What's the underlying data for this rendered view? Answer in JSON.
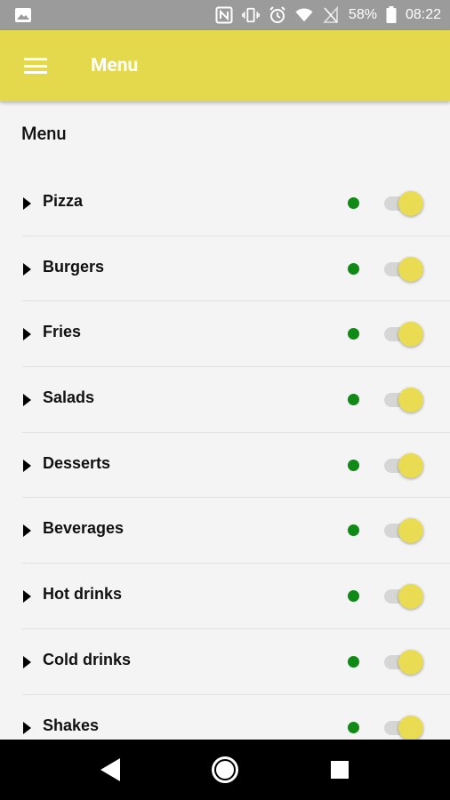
{
  "status_bar": {
    "battery_percent": "58%",
    "time": "08:22",
    "icons": [
      "gallery-icon",
      "nfc-icon",
      "vibrate-icon",
      "alarm-icon",
      "wifi-icon",
      "no-signal-icon",
      "battery-icon"
    ]
  },
  "app_bar": {
    "title": "Menu",
    "color": "#e4d84c"
  },
  "section": {
    "title": "Menu"
  },
  "items": [
    {
      "label": "Pizza",
      "enabled": true
    },
    {
      "label": "Burgers",
      "enabled": true
    },
    {
      "label": "Fries",
      "enabled": true
    },
    {
      "label": "Salads",
      "enabled": true
    },
    {
      "label": "Desserts",
      "enabled": true
    },
    {
      "label": "Beverages",
      "enabled": true
    },
    {
      "label": "Hot drinks",
      "enabled": true
    },
    {
      "label": "Cold drinks",
      "enabled": true
    },
    {
      "label": "Shakes",
      "enabled": true
    }
  ],
  "colors": {
    "status_dot": "#0f8a14",
    "toggle_thumb": "#e9dc53",
    "toggle_track": "#d6d6d6"
  },
  "nav_bar": {
    "icons": [
      "back-icon",
      "home-icon",
      "recents-icon"
    ]
  }
}
